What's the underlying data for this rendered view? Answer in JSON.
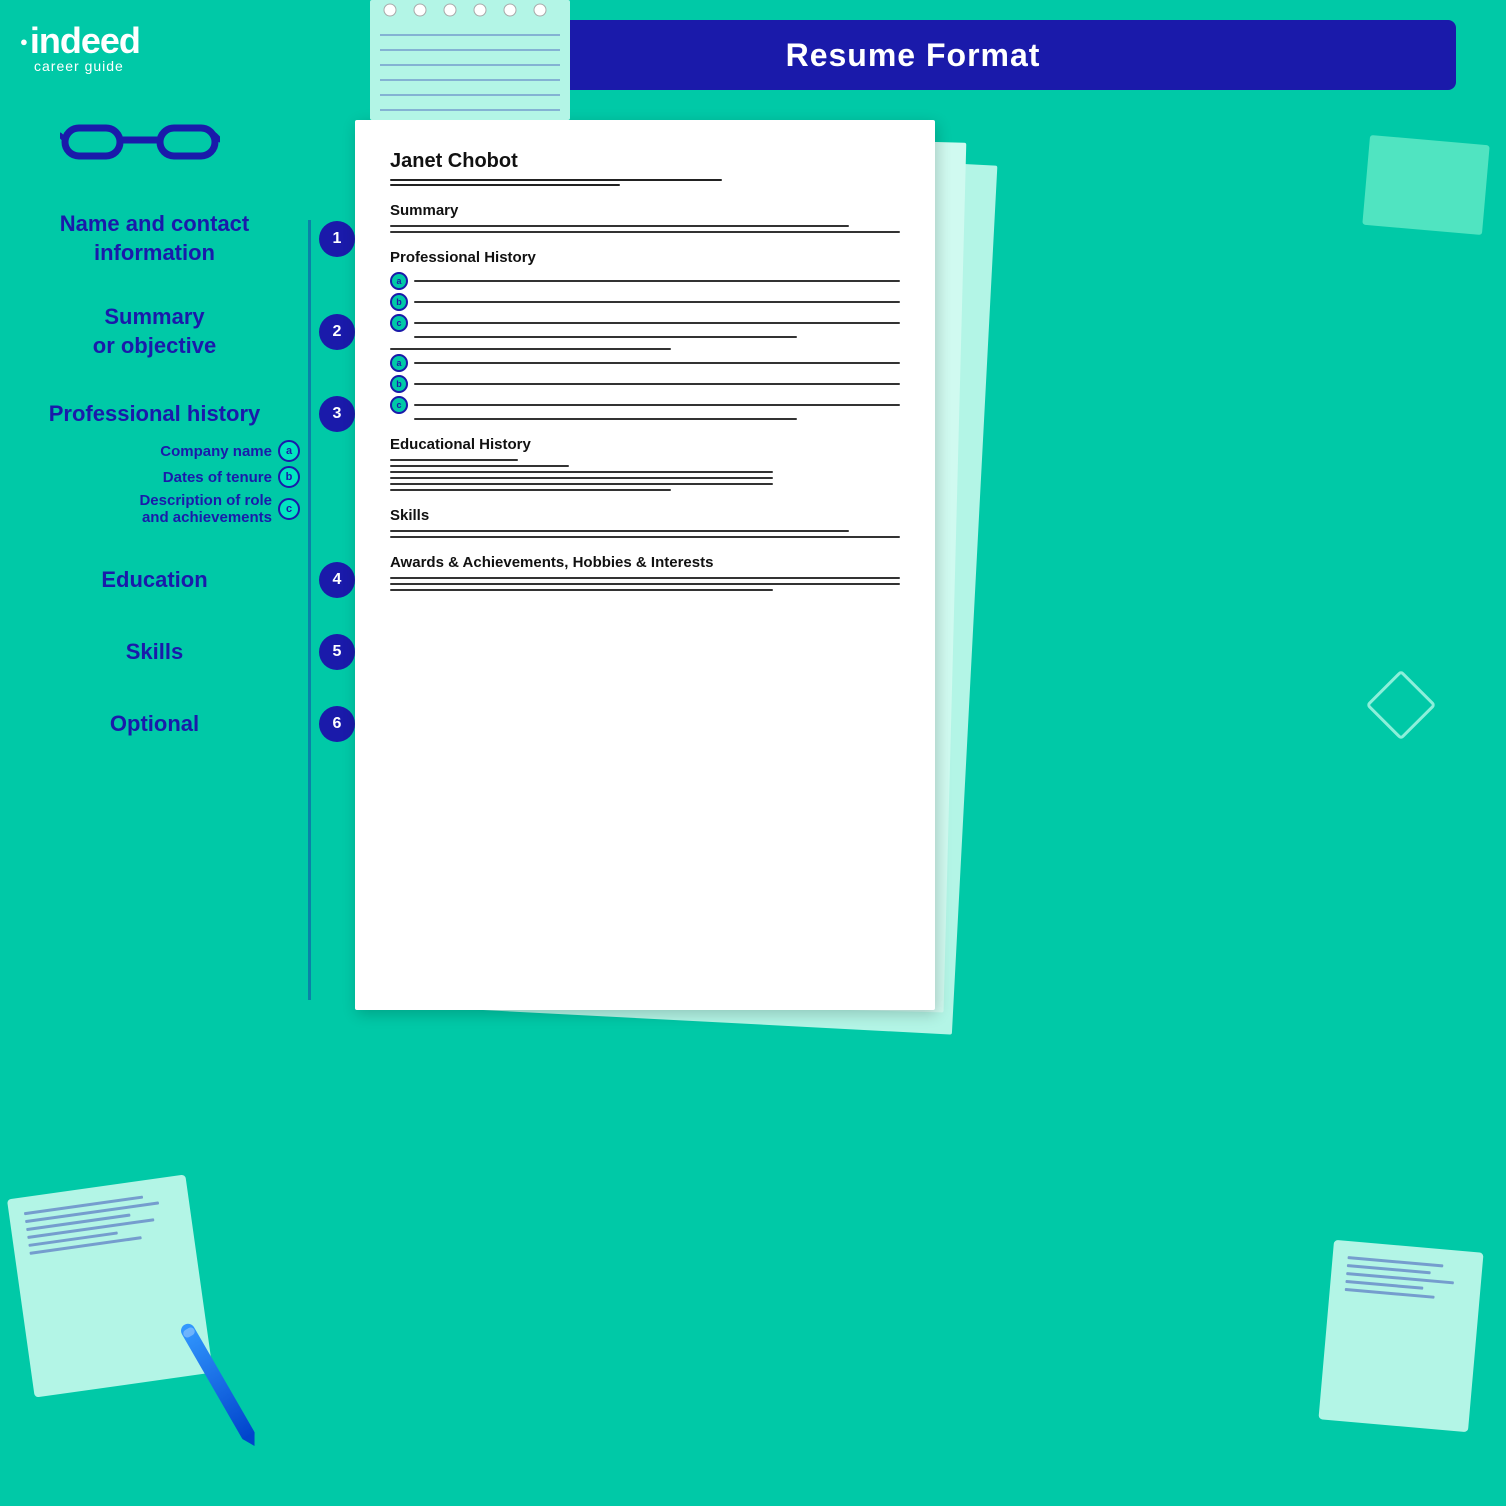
{
  "header": {
    "title": "Resume Format",
    "bg_color": "#1a1aaa"
  },
  "logo": {
    "brand": "indeed",
    "tagline": "career guide"
  },
  "sidebar": {
    "sections": [
      {
        "id": 1,
        "label": "Name and contact\ninformation",
        "number": "1",
        "sub_items": []
      },
      {
        "id": 2,
        "label": "Summary\nor objective",
        "number": "2",
        "sub_items": []
      },
      {
        "id": 3,
        "label": "Professional history",
        "number": "3",
        "sub_items": [
          {
            "letter": "a",
            "text": "Company name"
          },
          {
            "letter": "b",
            "text": "Dates of tenure"
          },
          {
            "letter": "c",
            "text": "Description of role\nand achievements"
          }
        ]
      },
      {
        "id": 4,
        "label": "Education",
        "number": "4",
        "sub_items": []
      },
      {
        "id": 5,
        "label": "Skills",
        "number": "5",
        "sub_items": []
      },
      {
        "id": 6,
        "label": "Optional",
        "number": "6",
        "sub_items": []
      }
    ]
  },
  "resume": {
    "name": "Janet Chobot",
    "sections": [
      {
        "title": "Summary"
      },
      {
        "title": "Professional History"
      },
      {
        "title": "Educational History"
      },
      {
        "title": "Skills"
      },
      {
        "title": "Awards & Achievements, Hobbies & Interests"
      }
    ]
  }
}
